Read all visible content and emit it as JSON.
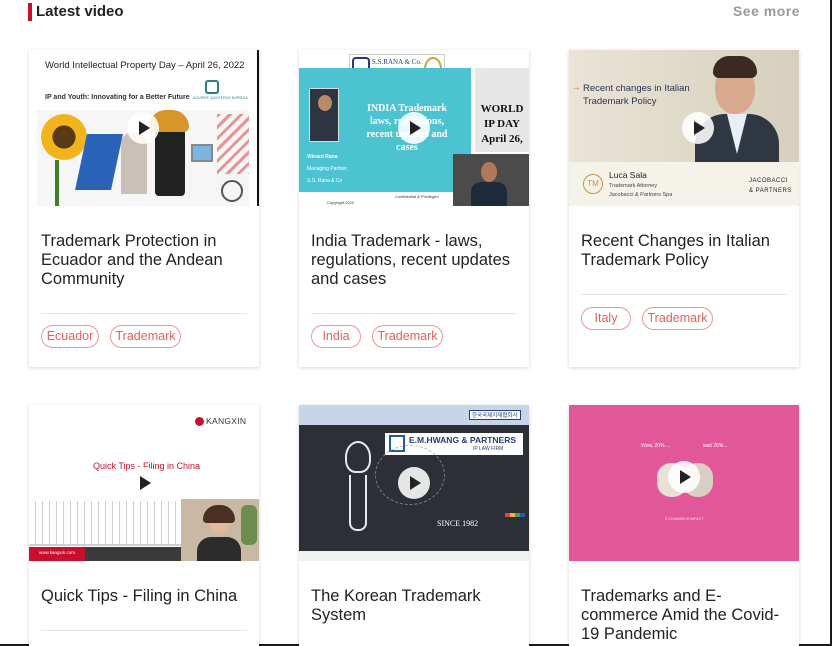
{
  "header": {
    "title": "Latest video",
    "see_more": "See more"
  },
  "thumbs": {
    "v1": {
      "heading": "World Intellectual Property Day – April 26, 2022",
      "subheading": "IP and Youth: Innovating for a Better Future",
      "logo": "AGUIRRE QUINTEROS NORIEGA"
    },
    "v2": {
      "firm": "S.S.RANA & Co.",
      "speaker_name": "Vikrant Rana",
      "speaker_role": "Managing Partner,",
      "speaker_org": "S.S. Rana & Co",
      "slide_title": "INDIA Trademark laws, regulations, recent updates and cases",
      "side_text": "WORLD IP DAY April 26,",
      "confidential": "Confidential & Privileged",
      "copyright": "Copyright 2022"
    },
    "v3": {
      "banner": "Recent changes in Italian Trademark Policy",
      "name": "Luca Sala",
      "role1": "Trademark Attorney",
      "role2": "Jacobacci & Partners Spa",
      "monogram": "TM",
      "logo1": "JACOBACCI",
      "logo2": "& PARTNERS"
    },
    "v4": {
      "logo": "KANGXIN",
      "heading": "Quick Tips - Filing in China",
      "url": "www.kangxin.com"
    },
    "v5": {
      "badge": "한국국제지재협회사",
      "firm": "E.M.HWANG & PARTNERS",
      "sub": "IP LAW FIRM",
      "since": "SINCE 1982"
    },
    "v6": {
      "bubble1": "Wow, 20% ...",
      "bubble2": "wait 20%... ",
      "caption": "E-COMMERCE IMPACT"
    }
  },
  "cards": [
    {
      "title": "Trademark Protection in Ecuador and the Andean Community",
      "tags": [
        "Ecuador",
        "Trademark"
      ]
    },
    {
      "title": "India Trademark - laws, regulations, recent updates and cases",
      "tags": [
        "India",
        "Trademark"
      ]
    },
    {
      "title": "Recent Changes in Italian Trademark Policy",
      "tags": [
        "Italy",
        "Trademark"
      ]
    },
    {
      "title": "Quick Tips - Filing in China",
      "tags": []
    },
    {
      "title": "The Korean Trademark System",
      "tags": []
    },
    {
      "title": "Trademarks and E-commerce Amid the Covid-19 Pandemic",
      "tags": []
    }
  ],
  "colors": {
    "accent": "#c8102e",
    "tag": "#e0625c",
    "teal": "#4cc3d0",
    "pink": "#e2579a"
  }
}
